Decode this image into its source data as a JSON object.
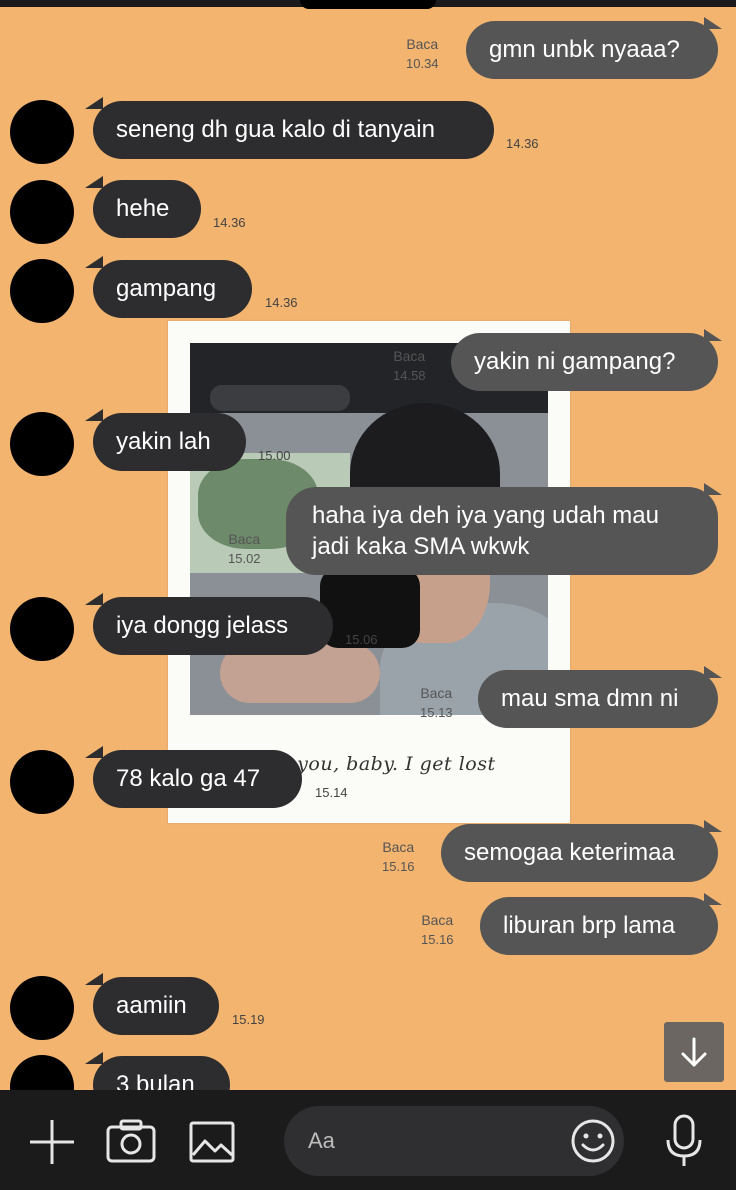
{
  "messages": [
    {
      "side": "out",
      "text": "gmn unbk nyaaa?",
      "read": "Baca",
      "time": "10.34"
    },
    {
      "side": "in",
      "text": "seneng dh gua kalo di tanyain",
      "time": "14.36"
    },
    {
      "side": "in",
      "text": "hehe",
      "time": "14.36"
    },
    {
      "side": "in",
      "text": "gampang",
      "time": "14.36"
    },
    {
      "side": "out",
      "text": "yakin ni gampang?",
      "read": "Baca",
      "time": "14.58"
    },
    {
      "side": "in",
      "text": "yakin lah",
      "time": "15.00"
    },
    {
      "side": "out",
      "text_lines": [
        "haha iya deh iya yang udah mau",
        "jadi kaka SMA wkwk"
      ],
      "read": "Baca",
      "time": "15.02"
    },
    {
      "side": "in",
      "text": "iya dongg jelass",
      "time": "15.06"
    },
    {
      "side": "out",
      "text": "mau sma dmn ni",
      "read": "Baca",
      "time": "15.13"
    },
    {
      "side": "in",
      "text": "78 kalo ga 47",
      "time": "15.14"
    },
    {
      "side": "out",
      "text": "semogaa keterimaa",
      "read": "Baca",
      "time": "15.16"
    },
    {
      "side": "out",
      "text": "liburan brp lama",
      "read": "Baca",
      "time": "15.16"
    },
    {
      "side": "in",
      "text": "aamiin",
      "time": "15.19"
    },
    {
      "side": "in",
      "text": "3 bulan",
      "time": ""
    }
  ],
  "wallpaper": {
    "caption": "I see you, baby. I get lost"
  },
  "input": {
    "placeholder": "Aa"
  },
  "icons": {
    "add": "plus-icon",
    "camera": "camera-icon",
    "gallery": "image-icon",
    "emoji": "smiley-icon",
    "mic": "microphone-icon",
    "scroll": "arrow-down-icon"
  },
  "colors": {
    "background": "#f2b46f",
    "incoming_bubble": "#2d2d2f",
    "outgoing_bubble": "#555556",
    "bottom_bar": "#1b1b1b"
  }
}
